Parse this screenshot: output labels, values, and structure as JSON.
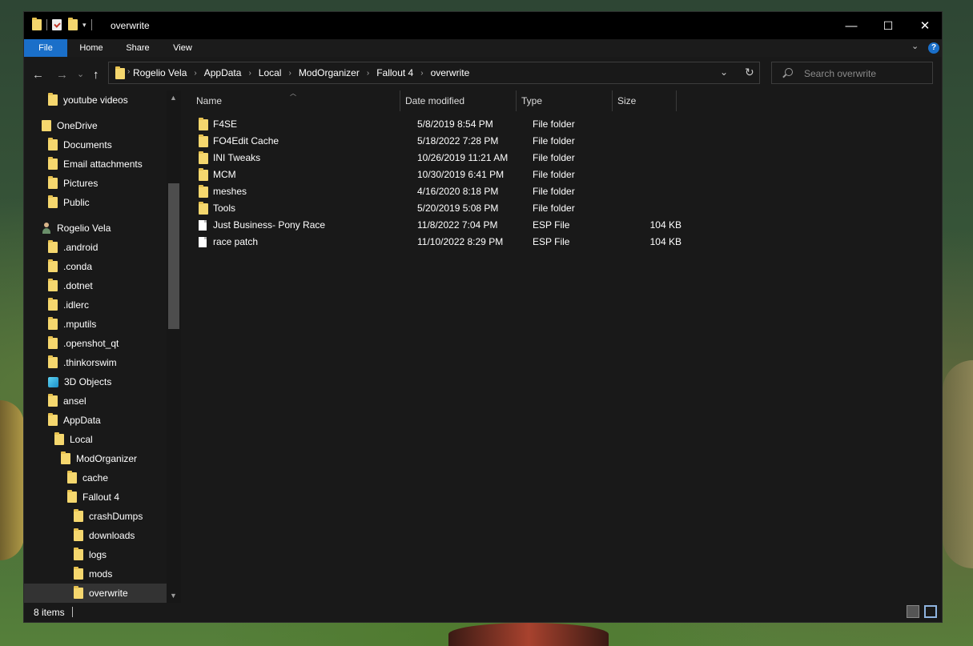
{
  "window": {
    "title": "overwrite"
  },
  "window_controls": {
    "minimize": "—",
    "maximize": "☐",
    "close": "✕"
  },
  "ribbon": {
    "tabs": [
      "File",
      "Home",
      "Share",
      "View"
    ],
    "help": "?"
  },
  "nav": {
    "back": "←",
    "forward": "→",
    "recent": "⌄",
    "up": "↑",
    "refresh": "↻",
    "dropdown": "⌄"
  },
  "breadcrumb": [
    "Rogelio Vela",
    "AppData",
    "Local",
    "ModOrganizer",
    "Fallout 4",
    "overwrite"
  ],
  "search": {
    "placeholder": "Search overwrite"
  },
  "sidebar": {
    "items": [
      {
        "label": "youtube videos",
        "icon": "folder-icon"
      },
      {
        "label": "OneDrive",
        "icon": "onedrive-folder-icon"
      },
      {
        "label": "Documents",
        "icon": "folder-icon"
      },
      {
        "label": "Email attachments",
        "icon": "folder-icon"
      },
      {
        "label": "Pictures",
        "icon": "folder-icon"
      },
      {
        "label": "Public",
        "icon": "folder-icon"
      },
      {
        "label": "Rogelio Vela",
        "icon": "user-icon"
      },
      {
        "label": ".android",
        "icon": "folder-icon"
      },
      {
        "label": ".conda",
        "icon": "folder-icon"
      },
      {
        "label": ".dotnet",
        "icon": "folder-icon"
      },
      {
        "label": ".idlerc",
        "icon": "folder-icon"
      },
      {
        "label": ".mputils",
        "icon": "folder-icon"
      },
      {
        "label": ".openshot_qt",
        "icon": "folder-icon"
      },
      {
        "label": ".thinkorswim",
        "icon": "folder-icon"
      },
      {
        "label": "3D Objects",
        "icon": "3d-objects-icon"
      },
      {
        "label": "ansel",
        "icon": "folder-icon"
      },
      {
        "label": "AppData",
        "icon": "folder-icon"
      },
      {
        "label": "Local",
        "icon": "folder-icon"
      },
      {
        "label": "ModOrganizer",
        "icon": "folder-icon"
      },
      {
        "label": "cache",
        "icon": "folder-icon"
      },
      {
        "label": "Fallout 4",
        "icon": "folder-icon"
      },
      {
        "label": "crashDumps",
        "icon": "folder-icon"
      },
      {
        "label": "downloads",
        "icon": "folder-icon"
      },
      {
        "label": "logs",
        "icon": "folder-icon"
      },
      {
        "label": "mods",
        "icon": "folder-icon"
      },
      {
        "label": "overwrite",
        "icon": "folder-icon",
        "selected": true
      }
    ]
  },
  "columns": {
    "name": "Name",
    "date": "Date modified",
    "type": "Type",
    "size": "Size"
  },
  "files": [
    {
      "name": "F4SE",
      "date": "5/8/2019 8:54 PM",
      "type": "File folder",
      "size": "",
      "icon": "folder-icon"
    },
    {
      "name": "FO4Edit Cache",
      "date": "5/18/2022 7:28 PM",
      "type": "File folder",
      "size": "",
      "icon": "folder-icon"
    },
    {
      "name": "INI Tweaks",
      "date": "10/26/2019 11:21 AM",
      "type": "File folder",
      "size": "",
      "icon": "folder-icon"
    },
    {
      "name": "MCM",
      "date": "10/30/2019 6:41 PM",
      "type": "File folder",
      "size": "",
      "icon": "folder-icon"
    },
    {
      "name": "meshes",
      "date": "4/16/2020 8:18 PM",
      "type": "File folder",
      "size": "",
      "icon": "folder-icon"
    },
    {
      "name": "Tools",
      "date": "5/20/2019 5:08 PM",
      "type": "File folder",
      "size": "",
      "icon": "folder-icon"
    },
    {
      "name": "Just Business- Pony Race",
      "date": "11/8/2022 7:04 PM",
      "type": "ESP File",
      "size": "104 KB",
      "icon": "file-icon"
    },
    {
      "name": "race patch",
      "date": "11/10/2022 8:29 PM",
      "type": "ESP File",
      "size": "104 KB",
      "icon": "file-icon"
    }
  ],
  "status": {
    "item_count": "8 items"
  },
  "colors": {
    "accent": "#1a6fc9",
    "folder": "#f5d76e",
    "bg": "#191919",
    "titlebar": "#000000"
  }
}
